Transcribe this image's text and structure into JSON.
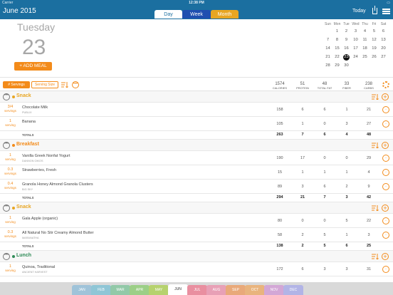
{
  "status": {
    "carrier": "Carrier",
    "time": "12:38 PM",
    "battery": ""
  },
  "header": {
    "title": "June 2015",
    "tabs": {
      "day": "Day",
      "week": "Week",
      "month": "Month"
    },
    "today": "Today"
  },
  "date": {
    "day_name": "Tuesday",
    "day_number": "23",
    "add_meal": "+ ADD MEAL"
  },
  "calendar": {
    "weekdays": [
      "Sun",
      "Mon",
      "Tue",
      "Wed",
      "Thu",
      "Fri",
      "Sat"
    ],
    "weeks": [
      [
        "",
        "1",
        "2",
        "3",
        "4",
        "5",
        "6"
      ],
      [
        "7",
        "8",
        "9",
        "10",
        "11",
        "12",
        "13"
      ],
      [
        "14",
        "15",
        "16",
        "17",
        "18",
        "19",
        "20"
      ],
      [
        "21",
        "22",
        "23",
        "24",
        "25",
        "26",
        "27"
      ],
      [
        "28",
        "29",
        "30",
        "",
        "",
        "",
        ""
      ]
    ]
  },
  "toolbar": {
    "servings": "# Servings",
    "serving_size": "Serving Size",
    "columns": [
      {
        "value": "1574",
        "label": "CALORIES"
      },
      {
        "value": "51",
        "label": "PROTEIN"
      },
      {
        "value": "48",
        "label": "TOTAL FAT"
      },
      {
        "value": "33",
        "label": "FIBER"
      },
      {
        "value": "238",
        "label": "CARBS"
      }
    ]
  },
  "meals": [
    {
      "name": "Snack",
      "color": "#e8a623",
      "totals_label": "TOTALS",
      "items": [
        {
          "servings": "3/4",
          "unit": "servings",
          "name": "Chocolate Milk",
          "brand": "PUBLIX",
          "values": [
            "158",
            "6",
            "6",
            "1",
            "21"
          ]
        },
        {
          "servings": "1",
          "unit": "serving",
          "name": "Banana",
          "brand": "",
          "values": [
            "105",
            "1",
            "0",
            "3",
            "27"
          ]
        }
      ],
      "totals": [
        "263",
        "7",
        "6",
        "4",
        "48"
      ]
    },
    {
      "name": "Breakfast",
      "color": "#f38b1a",
      "totals_label": "TOTALS",
      "items": [
        {
          "servings": "1",
          "unit": "serving",
          "name": "Vanilla Greek Nonfat Yogurt",
          "brand": "DANNON OIKOS",
          "values": [
            "190",
            "17",
            "0",
            "0",
            "29"
          ]
        },
        {
          "servings": "0.3",
          "unit": "servings",
          "name": "Strawberries, Fresh",
          "brand": "",
          "values": [
            "15",
            "1",
            "1",
            "1",
            "4"
          ]
        },
        {
          "servings": "0.4",
          "unit": "servings",
          "name": "Granola Honey Almond Granola Clusters",
          "brand": "BIG SKY",
          "values": [
            "89",
            "3",
            "6",
            "2",
            "9"
          ]
        }
      ],
      "totals": [
        "294",
        "21",
        "7",
        "3",
        "42"
      ]
    },
    {
      "name": "Snack",
      "color": "#e8a623",
      "totals_label": "TOTALS",
      "items": [
        {
          "servings": "1",
          "unit": "serving",
          "name": "Gala Apple (organic)",
          "brand": "",
          "values": [
            "80",
            "0",
            "0",
            "5",
            "22"
          ]
        },
        {
          "servings": "0.3",
          "unit": "servings",
          "name": "All Natural No Stir Creamy Almond Butter",
          "brand": "MARANATHA",
          "values": [
            "58",
            "2",
            "5",
            "1",
            "3"
          ]
        }
      ],
      "totals": [
        "138",
        "2",
        "5",
        "6",
        "25"
      ]
    },
    {
      "name": "Lunch",
      "color": "#2e8b57",
      "totals_label": "",
      "items": [
        {
          "servings": "1",
          "unit": "serving",
          "name": "Quinoa, Traditional",
          "brand": "ANCIENT HARVEST",
          "values": [
            "172",
            "6",
            "3",
            "3",
            "31"
          ]
        }
      ],
      "totals": null
    }
  ],
  "months": [
    {
      "label": "JAN",
      "color": "#9fc3d9"
    },
    {
      "label": "FEB",
      "color": "#8fc6d6"
    },
    {
      "label": "MAR",
      "color": "#92c9a8"
    },
    {
      "label": "APR",
      "color": "#9ccf87"
    },
    {
      "label": "MAY",
      "color": "#b6d26e"
    },
    {
      "label": "JUN",
      "color": "#ffffff"
    },
    {
      "label": "JUL",
      "color": "#e98fa0"
    },
    {
      "label": "AUG",
      "color": "#e8a0b6"
    },
    {
      "label": "SEP",
      "color": "#e9a97a"
    },
    {
      "label": "OCT",
      "color": "#e9b47e"
    },
    {
      "label": "NOV",
      "color": "#d3a7d6"
    },
    {
      "label": "DEC",
      "color": "#b2b4e6"
    }
  ]
}
